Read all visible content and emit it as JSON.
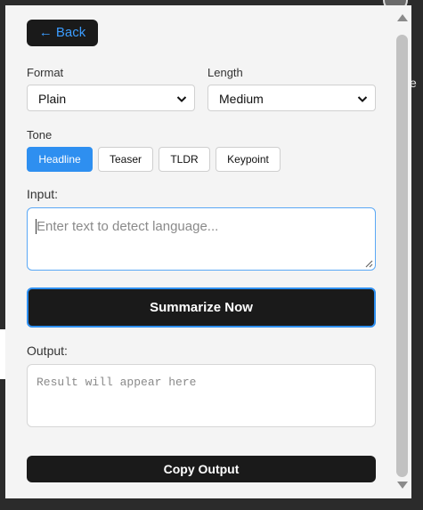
{
  "nav": {
    "back_label": "← Back"
  },
  "format": {
    "label": "Format",
    "selected": "Plain"
  },
  "length": {
    "label": "Length",
    "selected": "Medium"
  },
  "tone": {
    "label": "Tone",
    "options": [
      "Headline",
      "Teaser",
      "TLDR",
      "Keypoint"
    ],
    "active": "Headline"
  },
  "input": {
    "label": "Input:",
    "placeholder": "Enter text to detect language..."
  },
  "actions": {
    "summarize_label": "Summarize Now",
    "copy_label": "Copy Output"
  },
  "output": {
    "label": "Output:",
    "placeholder": "Result will appear here"
  },
  "colors": {
    "accent": "#2e8ff0",
    "back_text": "#3b9cff",
    "dark_button": "#1a1a1a",
    "panel": "#f4f4f4",
    "backdrop": "#2b2b2b"
  },
  "icons": [
    "chevron-down-icon",
    "scroll-up-arrow-icon",
    "scroll-down-arrow-icon",
    "resize-grip-icon"
  ]
}
